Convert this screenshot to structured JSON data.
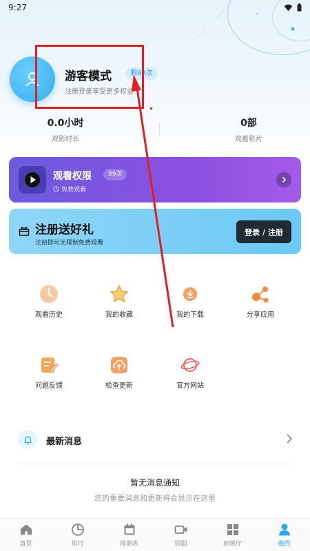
{
  "status_bar": {
    "time": "9:27"
  },
  "profile": {
    "name": "游客模式",
    "badge": "剩99次",
    "subtitle": "注册登录享受更多权益"
  },
  "stats": [
    {
      "value": "0.0小时",
      "label": "观影时长"
    },
    {
      "value": "0部",
      "label": "观看影片"
    }
  ],
  "vip_card": {
    "title": "观看权限",
    "badge": "99次",
    "subtitle": "免费观看"
  },
  "register_card": {
    "title": "注册送好礼",
    "subtitle": "注册即可无限制免费观看",
    "button": "登录 / 注册"
  },
  "features": [
    {
      "label": "观看历史",
      "icon": "clock-icon"
    },
    {
      "label": "我的收藏",
      "icon": "star-icon"
    },
    {
      "label": "我的下载",
      "icon": "download-icon"
    },
    {
      "label": "分享应用",
      "icon": "share-icon"
    },
    {
      "label": "问题反馈",
      "icon": "feedback-icon"
    },
    {
      "label": "检查更新",
      "icon": "update-icon"
    },
    {
      "label": "官方网站",
      "icon": "planet-icon"
    }
  ],
  "messages": {
    "title": "最新消息",
    "empty_title": "暂无消息通知",
    "empty_subtitle": "您的重要消息和更新将会显示在这里"
  },
  "bottom_nav": [
    {
      "label": "首页",
      "icon": "home-icon"
    },
    {
      "label": "排行",
      "icon": "ranking-icon"
    },
    {
      "label": "排期表",
      "icon": "calendar-icon"
    },
    {
      "label": "短剧",
      "icon": "video-icon"
    },
    {
      "label": "放映厅",
      "icon": "grid-icon"
    },
    {
      "label": "我的",
      "icon": "user-icon",
      "active": true
    }
  ],
  "colors": {
    "accent": "#2aa7ee",
    "vip_gradient_start": "#6b5be0",
    "vip_gradient_end": "#a45ae8",
    "register_bg": "#6cc8f4",
    "annotation": "#e02020"
  }
}
